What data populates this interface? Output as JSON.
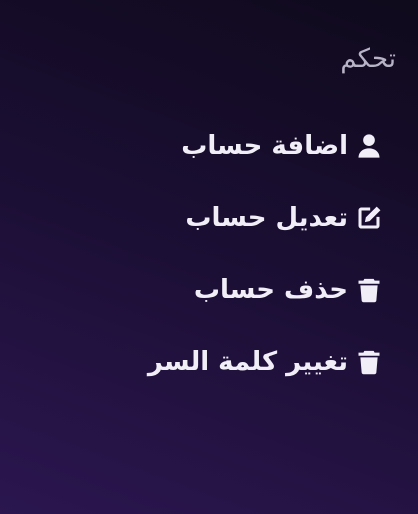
{
  "sidebar": {
    "section_title": "تحكم",
    "items": [
      {
        "label": "اضافة حساب",
        "icon": "user-icon"
      },
      {
        "label": "تعديل حساب",
        "icon": "edit-icon"
      },
      {
        "label": "حذف حساب",
        "icon": "trash-icon"
      },
      {
        "label": "تغيير كلمة السر",
        "icon": "trash-icon"
      }
    ]
  },
  "colors": {
    "background_top": "#0f0a1c",
    "background_bottom": "#2b164f",
    "title_text": "#b8b3c6",
    "item_text": "#f1eef7"
  }
}
